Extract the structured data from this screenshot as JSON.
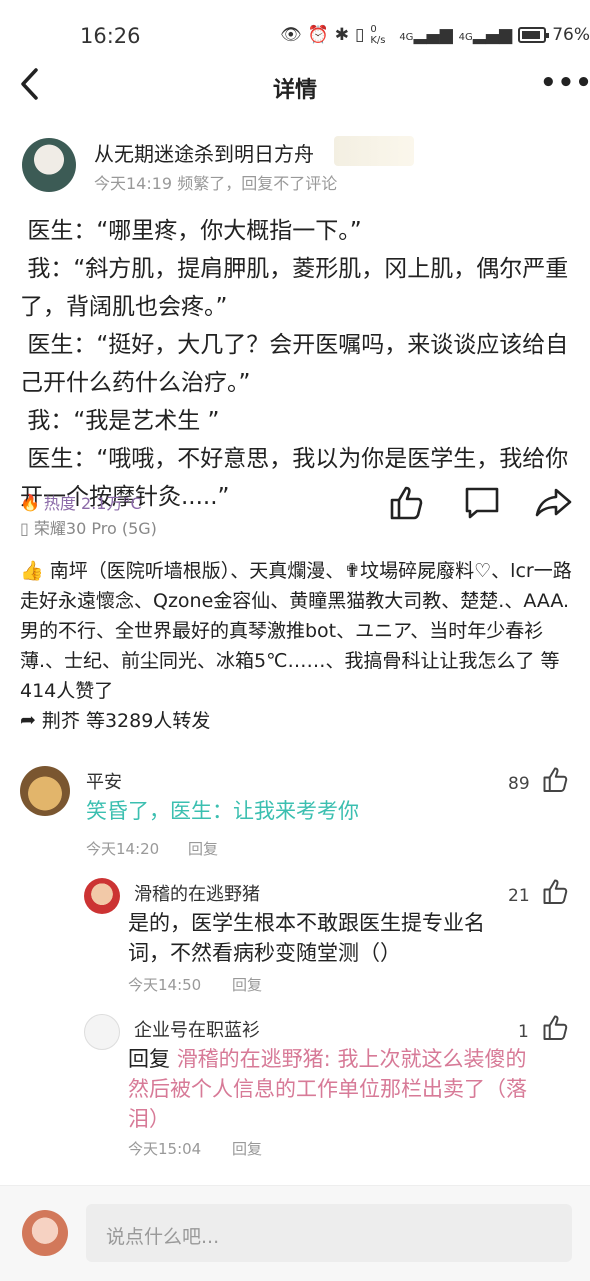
{
  "status_bar": {
    "time": "16:26",
    "network_speed": "0 K/s",
    "signal_1": "4G",
    "signal_2": "4G",
    "battery": "76%"
  },
  "header": {
    "title": "详情"
  },
  "post": {
    "author": "从无期迷途杀到明日方舟",
    "meta": "今天14:19  频繁了，回复不了评论",
    "lines": [
      " 医生：“哪里疼，你大概指一下。”",
      " 我：“斜方肌，提肩胛肌，菱形肌，冈上肌，偶尔严重了，背阔肌也会疼。”",
      " 医生：“挺好，大几了？会开医嘱吗，来谈谈应该给自己开什么药什么治疗。”",
      " 我：“我是艺术生 ”",
      " 医生：“哦哦，不好意思，我以为你是医学生，我给你开一个按摩针灸.....”"
    ],
    "heat": "热度 2.1万°C",
    "device": "荣耀30 Pro (5G)",
    "likes_text": "南坪（医院听墙根版）、天真爛漫、✟坟場碎屍廢料♡、lcr一路走好永遠懷念、Qzone金容仙、黄瞳黑猫教大司教、楚楚.、AAA.男的不行、全世界最好的真琴激推bot、ユニア、当时年少春衫薄.、士纪、前尘同光、冰箱5℃……、我搞骨科让让我怎么了 等414人赞了",
    "share_text": "荆芥 等3289人转发"
  },
  "comments": [
    {
      "name": "平安",
      "count": "89",
      "text": "笑昏了，医生：让我来考考你",
      "time": "今天14:20",
      "reply_label": "回复"
    },
    {
      "name": "滑稽的在逃野猪",
      "count": "21",
      "text": "是的，医学生根本不敢跟医生提专业名词，不然看病秒变随堂测（）",
      "time": "今天14:50",
      "reply_label": "回复"
    },
    {
      "name": "企业号在职蓝衫",
      "count": "1",
      "reply_prefix": "回复",
      "reply_to": "滑稽的在逃野猪:",
      "text": "我上次就这么装傻的然后被个人信息的工作单位那栏出卖了（落泪）",
      "time": "今天15:04",
      "reply_label": "回复"
    }
  ],
  "input": {
    "placeholder": "说点什么吧..."
  },
  "colors": {
    "accent_teal": "#3bbfb0",
    "reply_pink": "#d77a97",
    "heat_purple": "#8b6aa8"
  }
}
